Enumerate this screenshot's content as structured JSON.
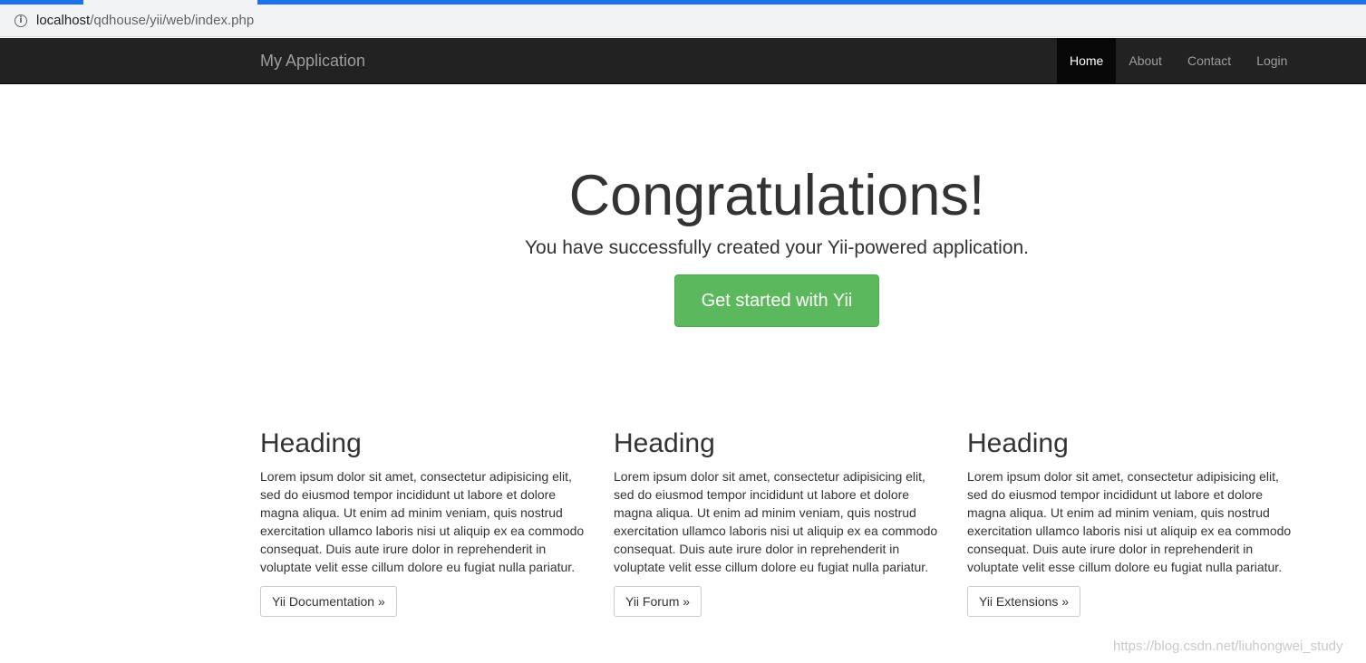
{
  "browser": {
    "url_host": "localhost",
    "url_path": "/qdhouse/yii/web/index.php",
    "info_icon": "info-icon"
  },
  "navbar": {
    "brand": "My Application",
    "items": [
      {
        "label": "Home",
        "active": true
      },
      {
        "label": "About",
        "active": false
      },
      {
        "label": "Contact",
        "active": false
      },
      {
        "label": "Login",
        "active": false
      }
    ]
  },
  "jumbotron": {
    "title": "Congratulations!",
    "lead": "You have successfully created your Yii-powered application.",
    "button": "Get started with Yii"
  },
  "columns": [
    {
      "heading": "Heading",
      "text": "Lorem ipsum dolor sit amet, consectetur adipisicing elit, sed do eiusmod tempor incididunt ut labore et dolore magna aliqua. Ut enim ad minim veniam, quis nostrud exercitation ullamco laboris nisi ut aliquip ex ea commodo consequat. Duis aute irure dolor in reprehenderit in voluptate velit esse cillum dolore eu fugiat nulla pariatur.",
      "button": "Yii Documentation »"
    },
    {
      "heading": "Heading",
      "text": "Lorem ipsum dolor sit amet, consectetur adipisicing elit, sed do eiusmod tempor incididunt ut labore et dolore magna aliqua. Ut enim ad minim veniam, quis nostrud exercitation ullamco laboris nisi ut aliquip ex ea commodo consequat. Duis aute irure dolor in reprehenderit in voluptate velit esse cillum dolore eu fugiat nulla pariatur.",
      "button": "Yii Forum »"
    },
    {
      "heading": "Heading",
      "text": "Lorem ipsum dolor sit amet, consectetur adipisicing elit, sed do eiusmod tempor incididunt ut labore et dolore magna aliqua. Ut enim ad minim veniam, quis nostrud exercitation ullamco laboris nisi ut aliquip ex ea commodo consequat. Duis aute irure dolor in reprehenderit in voluptate velit esse cillum dolore eu fugiat nulla pariatur.",
      "button": "Yii Extensions »"
    }
  ],
  "watermark": "https://blog.csdn.net/liuhongwei_study",
  "colors": {
    "navbar_bg": "#222222",
    "navbar_active_bg": "#080808",
    "success": "#5cb85c",
    "text": "#333333"
  }
}
